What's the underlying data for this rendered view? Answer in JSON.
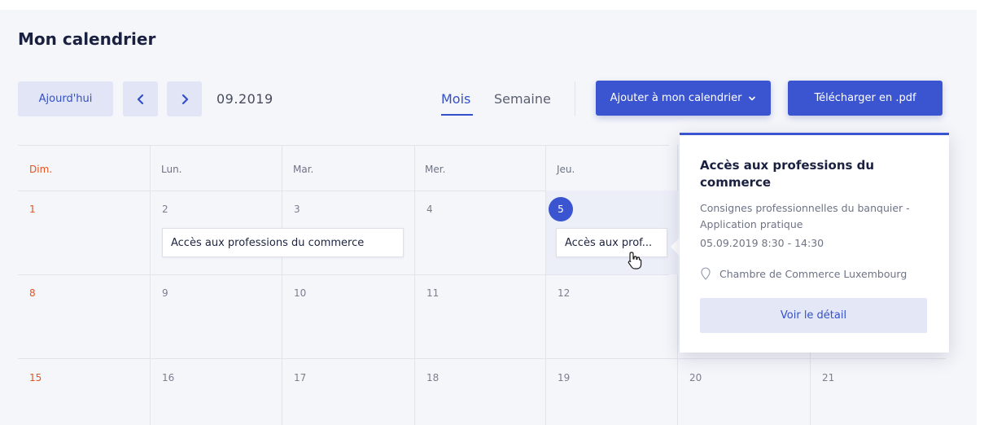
{
  "header": {
    "title": "Mon calendrier"
  },
  "toolbar": {
    "today_label": "Ajourd'hui",
    "month_label": "09.2019",
    "view_tabs": [
      {
        "label": "Mois",
        "active": true
      },
      {
        "label": "Semaine",
        "active": false
      }
    ],
    "add_calendar_label": "Ajouter à mon calendrier",
    "download_label": "Télécharger en .pdf"
  },
  "calendar": {
    "day_names": [
      "Dim.",
      "Lun.",
      "Mar.",
      "Mer.",
      "Jeu."
    ],
    "weeks": [
      [
        "1",
        "2",
        "3",
        "4",
        "5"
      ],
      [
        "8",
        "9",
        "10",
        "11",
        "12"
      ],
      [
        "15",
        "16",
        "17",
        "18",
        "19",
        "20",
        "21"
      ]
    ],
    "today": "5",
    "events": [
      {
        "label": "Accès aux professions du commerce"
      },
      {
        "label": "Accès aux prof..."
      }
    ]
  },
  "popover": {
    "title": "Accès aux professions du commerce",
    "subtitle": "Consignes professionnelles du banquier - Application pratique",
    "datetime": "05.09.2019 8:30 - 14:30",
    "location": "Chambre de Commerce Luxembourg",
    "detail_button": "Voir le détail"
  },
  "colors": {
    "accent": "#3a55cf",
    "sunday": "#e2531f",
    "panel_bg": "#f5f6fa"
  },
  "icons": {
    "prev": "chevron-left-icon",
    "next": "chevron-right-icon",
    "dropdown": "chevron-down-icon",
    "location": "location-pin-icon",
    "cursor": "hand-pointer-icon"
  }
}
